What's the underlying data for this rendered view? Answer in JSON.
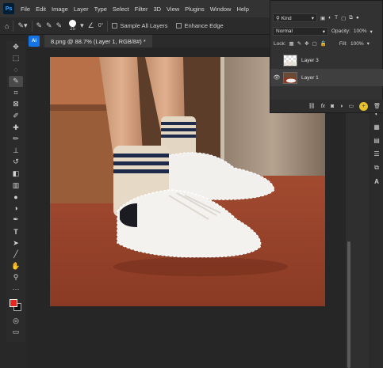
{
  "app": {
    "logo": "Ps"
  },
  "menu": [
    "File",
    "Edit",
    "Image",
    "Layer",
    "Type",
    "Select",
    "Filter",
    "3D",
    "View",
    "Plugins",
    "Window",
    "Help"
  ],
  "options": {
    "brush_size": "25",
    "angle": "0°",
    "sample_all_layers": "Sample All Layers",
    "enhance_edge": "Enhance Edge"
  },
  "document": {
    "tab_title": "8.png @ 88.7% (Layer 1, RGB/8#) *",
    "tab_icon": "Ai"
  },
  "layers_panel": {
    "filter_kind": "Kind",
    "blend_mode": "Normal",
    "opacity_label": "Opacity:",
    "opacity_value": "100%",
    "lock_label": "Lock:",
    "fill_label": "Fill:",
    "fill_value": "100%",
    "layers": [
      {
        "name": "Layer 3",
        "visible": false,
        "selected": false
      },
      {
        "name": "Layer 1",
        "visible": true,
        "selected": true
      }
    ]
  },
  "colors": {
    "foreground": "#e8261e",
    "background": "#111111",
    "accent": "#e8c12a"
  }
}
